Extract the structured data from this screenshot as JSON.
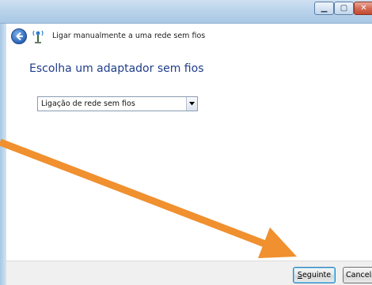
{
  "window": {
    "title": "Ligar manualmente a uma rede sem fios",
    "controls": {
      "minimize_icon": "minimize-icon",
      "maximize_icon": "maximize-icon",
      "close_icon": "close-icon"
    }
  },
  "nav": {
    "back_icon": "back-arrow-icon",
    "network_icon": "wireless-network-icon"
  },
  "main": {
    "heading": "Escolha um adaptador sem fios",
    "adapter_select": {
      "value": "Ligação de rede sem fios",
      "dropdown_icon": "chevron-down-icon"
    }
  },
  "footer": {
    "next_accesskey": "S",
    "next_rest": "eguinte",
    "cancel_label": "Cancelar"
  },
  "annotation": {
    "type": "arrow",
    "color": "#f0902f",
    "points_to": "next-button"
  },
  "colors": {
    "heading": "#1f3d8a",
    "titlebar": "#b8d2ea",
    "footer": "#f0f0f0",
    "close_button": "#c24a31"
  }
}
